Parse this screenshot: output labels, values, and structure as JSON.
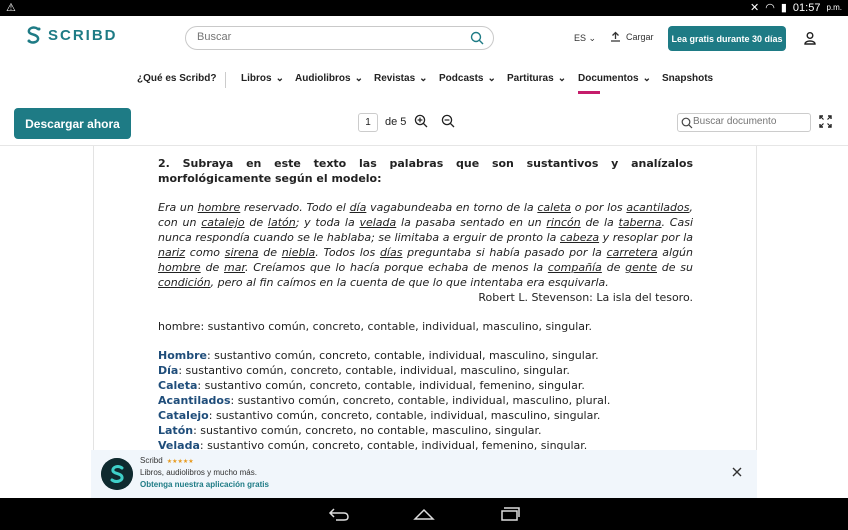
{
  "statusbar": {
    "time": "01:57",
    "ampm": "p.m."
  },
  "header": {
    "logo_text": "SCRIBD",
    "search_placeholder": "Buscar",
    "lang": "ES",
    "upload_label": "Cargar",
    "trial_label": "Lea gratis durante 30 días"
  },
  "nav": {
    "items": [
      {
        "label": "¿Qué es Scribd?"
      },
      {
        "label": "Libros"
      },
      {
        "label": "Audiolibros"
      },
      {
        "label": "Revistas"
      },
      {
        "label": "Podcasts"
      },
      {
        "label": "Partituras"
      },
      {
        "label": "Documentos"
      },
      {
        "label": "Snapshots"
      }
    ]
  },
  "toolbar": {
    "download_label": "Descargar ahora",
    "page_current": "1",
    "page_of": "de 5",
    "doc_search_placeholder": "Buscar documento"
  },
  "doc": {
    "question": "2. Subraya en este texto las palabras que son sustantivos y analízalos morfológicamente según el modelo:",
    "para_segments": [
      [
        "Era un ",
        false
      ],
      [
        "hombre",
        true
      ],
      [
        " reservado. Todo el ",
        false
      ],
      [
        "día",
        true
      ],
      [
        " vagabundeaba en torno de la ",
        false
      ],
      [
        "caleta",
        true
      ],
      [
        " o por los ",
        false
      ],
      [
        "acantilados",
        true
      ],
      [
        ", con un ",
        false
      ],
      [
        "catalejo",
        true
      ],
      [
        " de ",
        false
      ],
      [
        "latón",
        true
      ],
      [
        "; y toda la ",
        false
      ],
      [
        "velada",
        true
      ],
      [
        " la pasaba sentado en un ",
        false
      ],
      [
        "rincón",
        true
      ],
      [
        " de la ",
        false
      ],
      [
        "taberna",
        true
      ],
      [
        ". Casi nunca respondía cuando se le hablaba; se limitaba a erguir de pronto la ",
        false
      ],
      [
        "cabeza",
        true
      ],
      [
        " y resoplar por la ",
        false
      ],
      [
        "nariz",
        true
      ],
      [
        " como ",
        false
      ],
      [
        "sirena",
        true
      ],
      [
        " de ",
        false
      ],
      [
        "niebla",
        true
      ],
      [
        ". Todos los ",
        false
      ],
      [
        "días",
        true
      ],
      [
        " preguntaba si había pasado por la ",
        false
      ],
      [
        "carretera",
        true
      ],
      [
        " algún ",
        false
      ],
      [
        "hombre",
        true
      ],
      [
        " de ",
        false
      ],
      [
        "mar",
        true
      ],
      [
        ". Creíamos que lo hacía porque echaba de menos la ",
        false
      ],
      [
        "compañía",
        true
      ],
      [
        " de ",
        false
      ],
      [
        "gente",
        true
      ],
      [
        " de su ",
        false
      ],
      [
        "condición",
        true
      ],
      [
        ", pero al fin caímos en la cuenta de que lo que intentaba era esquivarla.",
        false
      ]
    ],
    "author": "Robert L. Stevenson: La isla del tesoro.",
    "model_line": "hombre: sustantivo común, concreto, contable, individual, masculino, singular.",
    "analysis": [
      {
        "word": "Hombre",
        "desc": ": sustantivo común, concreto, contable, individual, masculino, singular."
      },
      {
        "word": "Día",
        "desc": ":  sustantivo común, concreto, contable, individual, masculino, singular."
      },
      {
        "word": "Caleta",
        "desc": ":  sustantivo común, concreto, contable, individual, femenino, singular."
      },
      {
        "word": "Acantilados",
        "desc": ": sustantivo común, concreto, contable, individual, masculino, plural."
      },
      {
        "word": "Catalejo",
        "desc": ": sustantivo común, concreto, contable, individual, masculino, singular."
      },
      {
        "word": "Latón",
        "desc": ": sustantivo común, concreto, no contable, masculino, singular."
      },
      {
        "word": "Velada",
        "desc": ": sustantivo común, concreto, contable, individual, femenino, singular."
      }
    ]
  },
  "banner": {
    "app_name": "Scribd",
    "stars": "★★★★★",
    "desc": "Libros, audiolibros y mucho más.",
    "cta": "Obtenga nuestra aplicación gratis"
  },
  "colors": {
    "brand": "#1e7b85",
    "accent": "#c51d6b",
    "analysis_word": "#1f4d7a"
  }
}
